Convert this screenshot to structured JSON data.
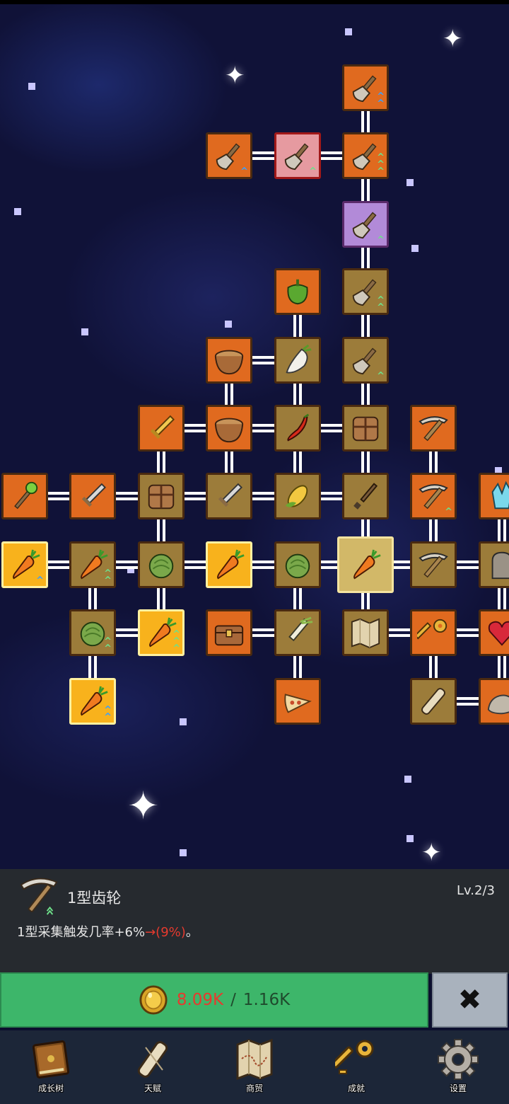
{
  "skill_tree": {
    "nodes": [
      {
        "id": "s1",
        "color": "orange",
        "icon": "shovel-icon",
        "up": "double-blue"
      },
      {
        "id": "s2",
        "color": "orange",
        "icon": "shovel-icon",
        "up": "single-blue"
      },
      {
        "id": "s3",
        "color": "red",
        "icon": "shovel-icon",
        "up": "single-green"
      },
      {
        "id": "s4",
        "color": "orange",
        "icon": "shovel-icon",
        "up": "triple-green"
      },
      {
        "id": "s5",
        "color": "purple",
        "icon": "shovel-icon",
        "up": "single-green"
      },
      {
        "id": "pepper",
        "color": "orange",
        "icon": "bell-pepper-icon"
      },
      {
        "id": "s6",
        "color": "olive",
        "icon": "shovel-icon",
        "up": "double-green"
      },
      {
        "id": "bowl1",
        "color": "orange",
        "icon": "bowl-icon"
      },
      {
        "id": "radish",
        "color": "olive",
        "icon": "radish-icon"
      },
      {
        "id": "s7",
        "color": "olive",
        "icon": "shovel-icon",
        "up": "single-green"
      },
      {
        "id": "sword1",
        "color": "orange",
        "icon": "gold-sword-icon"
      },
      {
        "id": "bowl2",
        "color": "orange",
        "icon": "bowl-icon"
      },
      {
        "id": "chili",
        "color": "olive",
        "icon": "chili-icon"
      },
      {
        "id": "crate1",
        "color": "olive",
        "icon": "crate-icon"
      },
      {
        "id": "pick1",
        "color": "orange",
        "icon": "pickaxe-icon"
      },
      {
        "id": "staff",
        "color": "orange",
        "icon": "staff-icon"
      },
      {
        "id": "sword2",
        "color": "orange",
        "icon": "sword-icon"
      },
      {
        "id": "crate2",
        "color": "olive",
        "icon": "crate-icon"
      },
      {
        "id": "sword3",
        "color": "olive",
        "icon": "sword-icon"
      },
      {
        "id": "corn",
        "color": "olive",
        "icon": "corn-icon"
      },
      {
        "id": "dagger",
        "color": "olive",
        "icon": "dagger-icon"
      },
      {
        "id": "pick2",
        "color": "orange",
        "icon": "pickaxe-icon",
        "up": "single-green"
      },
      {
        "id": "crystal",
        "color": "orange",
        "icon": "crystal-icon"
      },
      {
        "id": "carrot1",
        "color": "gold",
        "icon": "carrot-icon",
        "up": "single-blue"
      },
      {
        "id": "carrot2",
        "color": "olive",
        "icon": "carrot-icon",
        "up": "double-green"
      },
      {
        "id": "cabbage1",
        "color": "olive",
        "icon": "cabbage-icon"
      },
      {
        "id": "carrot3",
        "color": "gold",
        "icon": "carrot-icon"
      },
      {
        "id": "cabbage2",
        "color": "olive",
        "icon": "cabbage-icon"
      },
      {
        "id": "carrot-main",
        "color": "selected",
        "icon": "carrot-icon"
      },
      {
        "id": "pick3",
        "color": "olive",
        "icon": "pickaxe-icon"
      },
      {
        "id": "stone",
        "color": "olive",
        "icon": "tombstone-icon"
      },
      {
        "id": "cabbage3",
        "color": "olive",
        "icon": "cabbage-icon",
        "up": "double-green"
      },
      {
        "id": "carrot4",
        "color": "gold",
        "icon": "carrot-icon",
        "up": "triple-green"
      },
      {
        "id": "chest",
        "color": "orange",
        "icon": "chest-icon"
      },
      {
        "id": "leek",
        "color": "olive",
        "icon": "leek-icon"
      },
      {
        "id": "map",
        "color": "olive",
        "icon": "map-icon"
      },
      {
        "id": "key",
        "color": "orange",
        "icon": "key-icon"
      },
      {
        "id": "heart",
        "color": "orange",
        "icon": "heart-icon"
      },
      {
        "id": "carrot5",
        "color": "gold",
        "icon": "carrot-icon",
        "up": "double-blue"
      },
      {
        "id": "pizza",
        "color": "orange",
        "icon": "pizza-icon"
      },
      {
        "id": "scroll",
        "color": "olive",
        "icon": "scroll-icon"
      },
      {
        "id": "rock",
        "color": "orange",
        "icon": "rock-icon"
      }
    ]
  },
  "info_panel": {
    "title": "1型齿轮",
    "level": "Lv.2/3",
    "desc_prefix": "1型采集触发几率+6%",
    "desc_next": "→(9%)",
    "desc_suffix": "。",
    "icon": "pickaxe-icon"
  },
  "upgrade": {
    "cost_current": "8.09K",
    "separator": "/",
    "cost_required": "1.16K",
    "icon": "coin-icon"
  },
  "close_icon": "close-icon",
  "nav": [
    {
      "label": "成长树",
      "icon": "book-icon"
    },
    {
      "label": "天赋",
      "icon": "scroll-icon"
    },
    {
      "label": "商贸",
      "icon": "map-icon"
    },
    {
      "label": "成就",
      "icon": "key-icon"
    },
    {
      "label": "设置",
      "icon": "gear-icon"
    }
  ],
  "colors": {
    "background": "#101238",
    "orange": "#e06a1f",
    "olive": "#9c7c3a",
    "upgrade_green": "#3db66a",
    "cost_red": "#e63a2e",
    "nav_bg": "#1c2638"
  }
}
